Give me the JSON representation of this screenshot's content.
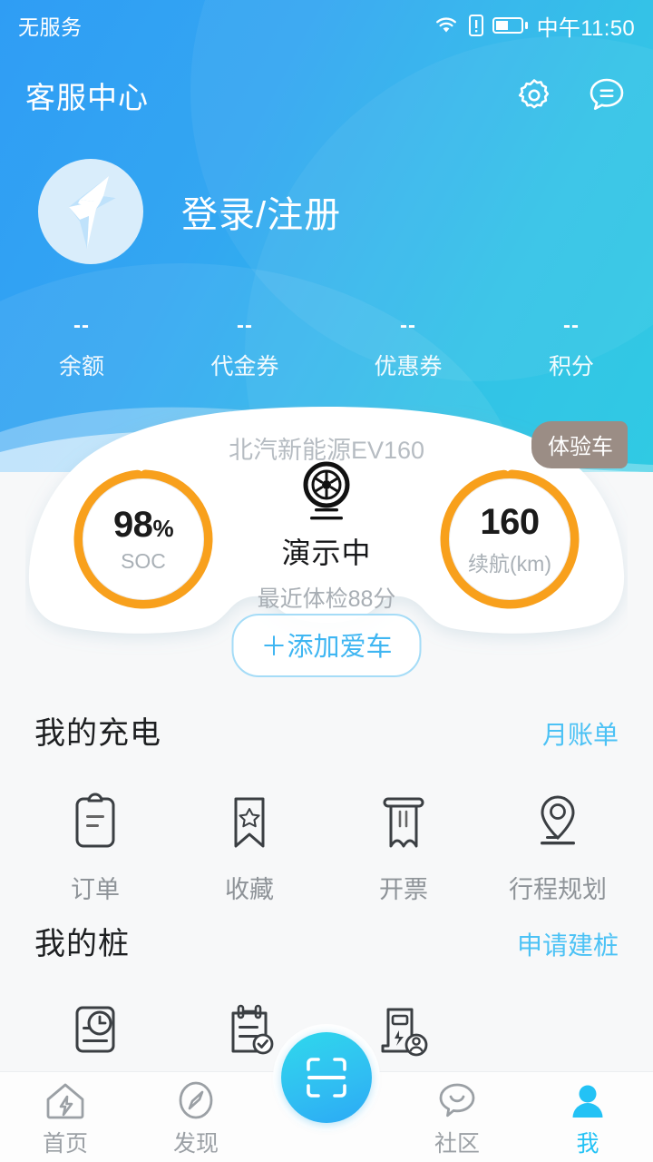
{
  "statusbar": {
    "carrier": "无服务",
    "time": "中午11:50",
    "icons": [
      "wifi-icon",
      "sim-alert-icon",
      "battery-icon"
    ]
  },
  "header": {
    "title": "客服中心",
    "settings_icon": "gear-icon",
    "message_icon": "chat-bubble-icon"
  },
  "profile": {
    "login_label": "登录/注册",
    "avatar_icon": "brand-lightning-logo"
  },
  "stats": [
    {
      "value": "--",
      "label": "余额"
    },
    {
      "value": "--",
      "label": "代金券"
    },
    {
      "value": "--",
      "label": "优惠券"
    },
    {
      "value": "--",
      "label": "积分"
    }
  ],
  "car_card": {
    "model": "北汽新能源EV160",
    "badge": "体验车",
    "soc": {
      "value": "98",
      "unit": "%",
      "label": "SOC",
      "percent": 98
    },
    "range": {
      "value": "160",
      "label": "续航(km)",
      "percent": 98
    },
    "status": "演示中",
    "health": "最近体检88分",
    "wheel_icon": "tire-wheel-icon",
    "add_car_label": "＋添加爱车",
    "ring_color": "#F8A01C"
  },
  "sections": [
    {
      "title": "我的充电",
      "action": "月账单",
      "items": [
        {
          "label": "订单",
          "icon": "clipboard-icon"
        },
        {
          "label": "收藏",
          "icon": "bookmark-star-icon"
        },
        {
          "label": "开票",
          "icon": "invoice-icon"
        },
        {
          "label": "行程规划",
          "icon": "location-pin-icon"
        }
      ]
    },
    {
      "title": "我的桩",
      "action": "申请建桩",
      "items": [
        {
          "label": "",
          "icon": "clock-document-icon"
        },
        {
          "label": "",
          "icon": "checklist-check-icon"
        },
        {
          "label": "",
          "icon": "charging-pile-user-icon"
        }
      ]
    }
  ],
  "bottomnav": {
    "items": [
      {
        "label": "首页",
        "icon": "home-lightning-icon",
        "active": false
      },
      {
        "label": "发现",
        "icon": "compass-icon",
        "active": false
      },
      {
        "label": "社区",
        "icon": "community-chat-icon",
        "active": false
      },
      {
        "label": "我",
        "icon": "person-icon",
        "active": true
      }
    ],
    "fab_icon": "scan-qr-icon",
    "active_color": "#23c2f5"
  }
}
